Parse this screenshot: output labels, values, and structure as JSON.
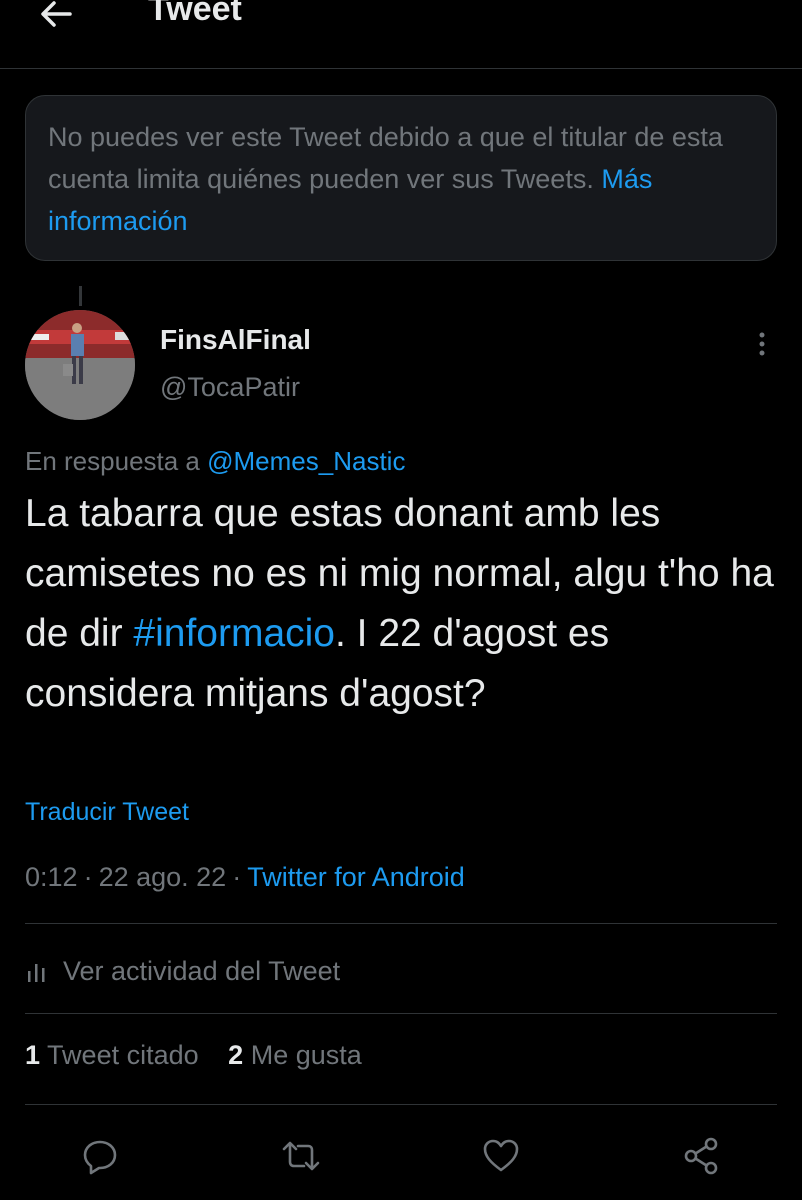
{
  "header": {
    "title": "Tweet",
    "back_icon": "arrow-left-icon"
  },
  "notice": {
    "text": "No puedes ver este Tweet debido a que el titular de esta cuenta limita quiénes pueden ver sus Tweets.",
    "link": "Más información"
  },
  "tweet": {
    "display_name": "FinsAlFinal",
    "handle": "@TocaPatir",
    "reply_prefix": "En respuesta a",
    "reply_to": "@Memes_Nastic",
    "text_part1": "La tabarra que estas donant amb les camisetes no es ni mig normal, algu t'ho ha de dir",
    "hashtag": "#informacio",
    "text_part2": ". I 22 d'agost es considera mitjans d'agost?",
    "translate": "Traducir Tweet",
    "time": "0:12",
    "date": "22 ago. 22",
    "source": "Twitter for Android",
    "separator": "·"
  },
  "activity": {
    "label": "Ver actividad del Tweet",
    "icon": "analytics-icon"
  },
  "stats": {
    "quotes_count": "1",
    "quotes_label": "Tweet citado",
    "likes_count": "2",
    "likes_label": "Me gusta"
  },
  "actions": [
    "reply-icon",
    "retweet-icon",
    "like-icon",
    "share-icon"
  ],
  "colors": {
    "background": "#000000",
    "accent": "#1d9bf0",
    "muted": "#71767b",
    "text": "#e7e9ea",
    "border": "#2f3336"
  }
}
